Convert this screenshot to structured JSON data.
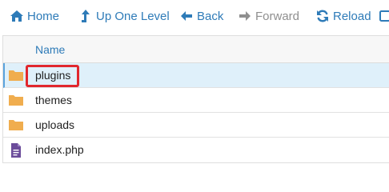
{
  "toolbar": {
    "home": {
      "label": "Home",
      "icon": "home-icon"
    },
    "up": {
      "label": "Up One Level",
      "icon": "arrow-up-icon"
    },
    "back": {
      "label": "Back",
      "icon": "arrow-left-icon"
    },
    "forward": {
      "label": "Forward",
      "icon": "arrow-right-icon"
    },
    "reload": {
      "label": "Reload",
      "icon": "reload-icon"
    },
    "more": {
      "label": "",
      "icon": "checkbox-icon"
    }
  },
  "table": {
    "header": {
      "name": "Name"
    },
    "rows": [
      {
        "name": "plugins",
        "icon": "folder-icon",
        "selected": true
      },
      {
        "name": "themes",
        "icon": "folder-icon",
        "selected": false
      },
      {
        "name": "uploads",
        "icon": "folder-icon",
        "selected": false
      },
      {
        "name": "index.php",
        "icon": "file-icon",
        "selected": false
      }
    ]
  },
  "colors": {
    "link": "#2e7bb8",
    "disabled": "#8f8f8f",
    "folder": "#f0ad4e",
    "file": "#6b4c9a",
    "selected_row": "#dff0fa",
    "highlight": "#e1272d"
  }
}
